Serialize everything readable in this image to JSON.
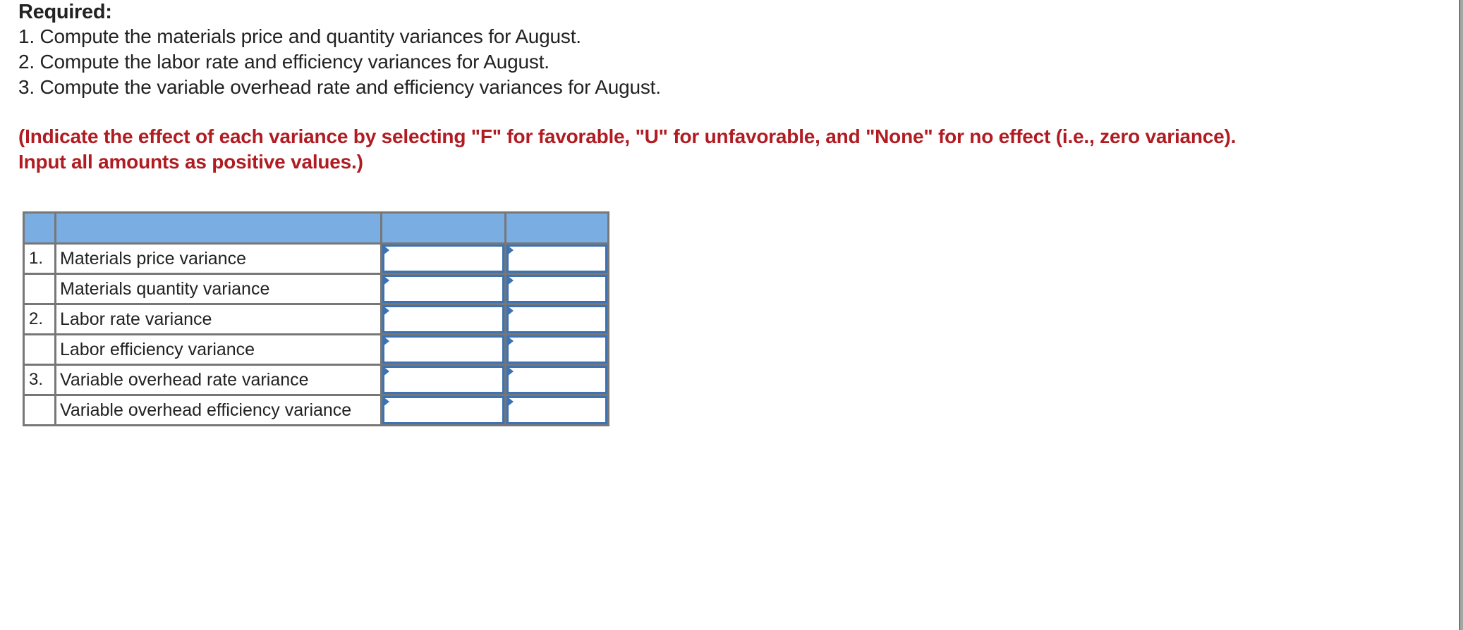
{
  "required": {
    "heading": "Required:",
    "items": [
      "1. Compute the materials price and quantity variances for August.",
      "2. Compute the labor rate and efficiency variances for August.",
      "3. Compute the variable overhead rate and efficiency variances for August."
    ]
  },
  "instruction": "(Indicate the effect of each variance by selecting \"F\" for favorable, \"U\" for unfavorable, and \"None\" for no effect (i.e., zero variance). Input all amounts as positive values.)",
  "colors": {
    "instruction_text": "#b01c22",
    "header_fill": "#7aaee2",
    "input_border": "#3d72b4",
    "grid_border": "#777777"
  },
  "table": {
    "headers": [
      "",
      "",
      "",
      ""
    ],
    "rows": [
      {
        "num": "1.",
        "label": "Materials price variance",
        "amount": "",
        "effect": ""
      },
      {
        "num": "",
        "label": "Materials quantity variance",
        "amount": "",
        "effect": ""
      },
      {
        "num": "2.",
        "label": "Labor rate variance",
        "amount": "",
        "effect": ""
      },
      {
        "num": "",
        "label": "Labor efficiency variance",
        "amount": "",
        "effect": ""
      },
      {
        "num": "3.",
        "label": "Variable overhead rate variance",
        "amount": "",
        "effect": ""
      },
      {
        "num": "",
        "label": "Variable overhead efficiency variance",
        "amount": "",
        "effect": ""
      }
    ]
  }
}
